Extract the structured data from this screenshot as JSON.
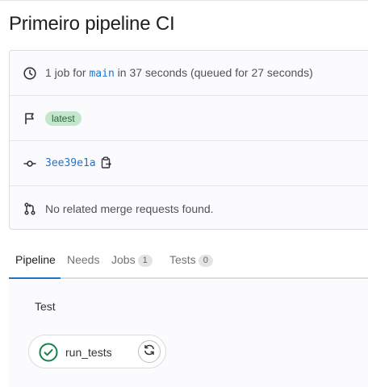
{
  "page": {
    "title": "Primeiro pipeline CI"
  },
  "info": {
    "jobs_prefix": "1 job for ",
    "branch": "main",
    "duration_text": " in 37 seconds (queued for 27 seconds)",
    "latest_badge": "latest",
    "commit_sha": "3ee39e1a",
    "merge_requests_text": "No related merge requests found."
  },
  "tabs": [
    {
      "label": "Pipeline",
      "count": null,
      "active": true
    },
    {
      "label": "Needs",
      "count": null,
      "active": false
    },
    {
      "label": "Jobs",
      "count": "1",
      "active": false
    },
    {
      "label": "Tests",
      "count": "0",
      "active": false
    }
  ],
  "graph": {
    "stage": "Test",
    "job": {
      "name": "run_tests",
      "status": "passed"
    }
  },
  "icons": {
    "clock": "clock-icon",
    "flag": "flag-icon",
    "commit": "commit-icon",
    "merge_request": "merge-request-icon",
    "copy": "copy-icon",
    "status": "status-success-icon",
    "retry": "retry-icon"
  },
  "colors": {
    "link": "#1f75cb",
    "success": "#108548",
    "badge_bg": "#c3e6cd",
    "badge_text": "#24663b"
  }
}
